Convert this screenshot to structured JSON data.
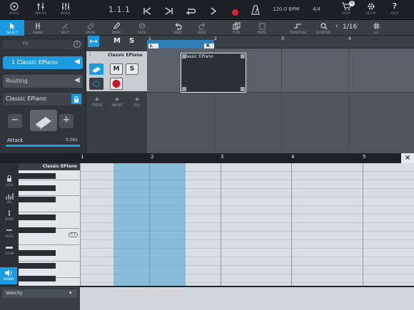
{
  "top_bar": {
    "buttons": [
      {
        "id": "music",
        "label": "MUSIC"
      },
      {
        "id": "inputs",
        "label": "INPUTS"
      },
      {
        "id": "mixer",
        "label": "MIXER"
      }
    ],
    "position": "1.1.1",
    "tempo": "120.0 BPM",
    "time_signature": "4/4",
    "right_buttons": [
      {
        "id": "shop",
        "label": "SHOP",
        "badge": "0"
      },
      {
        "id": "setup",
        "label": "SETUP"
      },
      {
        "id": "help",
        "label": "HELP"
      }
    ]
  },
  "toolbar": {
    "tools": [
      {
        "id": "select",
        "label": "SELECT"
      },
      {
        "id": "range",
        "label": "RANGE"
      },
      {
        "id": "split",
        "label": "SPLIT"
      },
      {
        "id": "erase",
        "label": "ERASE"
      },
      {
        "id": "draw",
        "label": "DRAW"
      },
      {
        "id": "mute",
        "label": "MUTE"
      },
      {
        "id": "undo",
        "label": "UNDO"
      },
      {
        "id": "redo",
        "label": "REDO"
      },
      {
        "id": "copy",
        "label": "COPY"
      },
      {
        "id": "paste",
        "label": "PASTE"
      },
      {
        "id": "transpose",
        "label": "TRANSPOSE"
      },
      {
        "id": "quantize",
        "label": "QUANTIZE"
      },
      {
        "id": "grid",
        "label": "1/4"
      }
    ],
    "quantize_value": "1/16"
  },
  "inspector": {
    "top_label": "FX",
    "track_name": "1 Classic EPiano",
    "routing": "Routing",
    "instrument": "Classic EPiano",
    "param_label": "Attack",
    "param_value": "0.06s"
  },
  "track_header": {
    "track_number": "1",
    "track_name": "Classic EPiano",
    "m_label": "M",
    "s_label": "S",
    "actions": [
      {
        "id": "create",
        "label": "CREATE"
      },
      {
        "id": "import",
        "label": "IMPORT"
      },
      {
        "id": "duo",
        "label": "DUO"
      }
    ]
  },
  "arrange": {
    "ruler": [
      "1",
      "2",
      "3",
      "4"
    ],
    "loop_left": "L",
    "loop_right": "R",
    "clip_name": "Classic EPiano"
  },
  "editor": {
    "ruler": [
      "1",
      "2",
      "3",
      "4",
      "5"
    ],
    "instrument_name": "Classic EPiano",
    "key_label": "C3",
    "side_buttons": [
      {
        "id": "lock",
        "label": "LOCK"
      },
      {
        "id": "vel",
        "label": "VEL"
      },
      {
        "id": "more",
        "label": "MORE"
      },
      {
        "id": "level",
        "label": "LEVEL"
      },
      {
        "id": "zoom",
        "label": "ZOOM"
      },
      {
        "id": "sound",
        "label": "SOUND"
      }
    ],
    "lane_selector": "Velocity",
    "close": "×"
  }
}
